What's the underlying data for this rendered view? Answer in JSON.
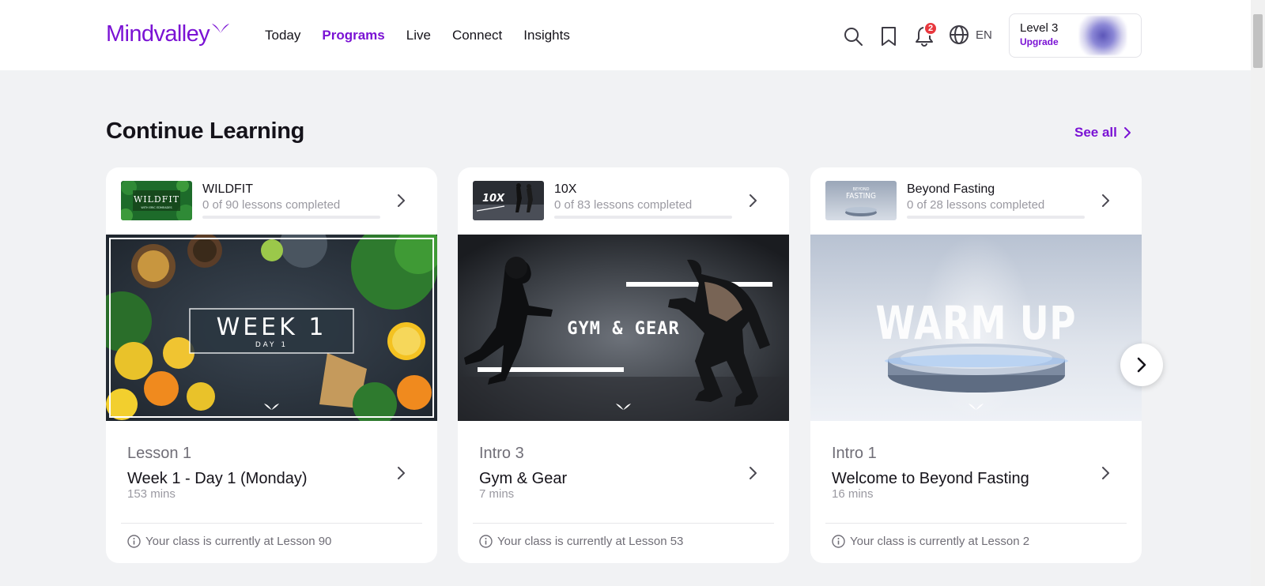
{
  "header": {
    "logo": "Mindvalley",
    "nav": [
      "Today",
      "Programs",
      "Live",
      "Connect",
      "Insights"
    ],
    "active_nav": "Programs",
    "notification_count": "2",
    "language": "EN",
    "profile": {
      "level": "Level 3",
      "upgrade": "Upgrade"
    }
  },
  "section": {
    "title": "Continue Learning",
    "see_all": "See all"
  },
  "cards": [
    {
      "program": "WILDFIT",
      "progress_text": "0 of 90 lessons completed",
      "progress": 0,
      "thumb_text": "WILDFIT",
      "thumb_sub": "WITH ERIC EDMEADES",
      "hero_title": "WEEK 1",
      "hero_sub": "DAY 1",
      "lesson_label": "Lesson 1",
      "lesson_title": "Week 1 - Day 1 (Monday)",
      "duration": "153 mins",
      "class_info": "Your class is currently at Lesson 90"
    },
    {
      "program": "10X",
      "progress_text": "0 of 83 lessons completed",
      "progress": 0,
      "thumb_text": "10X",
      "thumb_sub": "",
      "hero_title": "GYM & GEAR",
      "hero_sub": "",
      "lesson_label": "Intro 3",
      "lesson_title": "Gym & Gear",
      "duration": "7 mins",
      "class_info": "Your class is currently at Lesson 53"
    },
    {
      "program": "Beyond Fasting",
      "progress_text": "0 of 28 lessons completed",
      "progress": 0,
      "thumb_text": "FASTING",
      "thumb_sub": "BEYOND",
      "hero_title": "WARM UP",
      "hero_sub": "",
      "lesson_label": "Intro 1",
      "lesson_title": "Welcome to Beyond Fasting",
      "duration": "16 mins",
      "class_info": "Your class is currently at Lesson 2"
    }
  ],
  "colors": {
    "brand": "#7a12d4",
    "badge": "#e8383e",
    "background": "#f1f2f4"
  },
  "icons": [
    "mindvalley-logo-icon",
    "search-icon",
    "bookmark-icon",
    "bell-icon",
    "globe-icon",
    "chevron-right-icon",
    "info-icon",
    "carousel-next-icon"
  ]
}
